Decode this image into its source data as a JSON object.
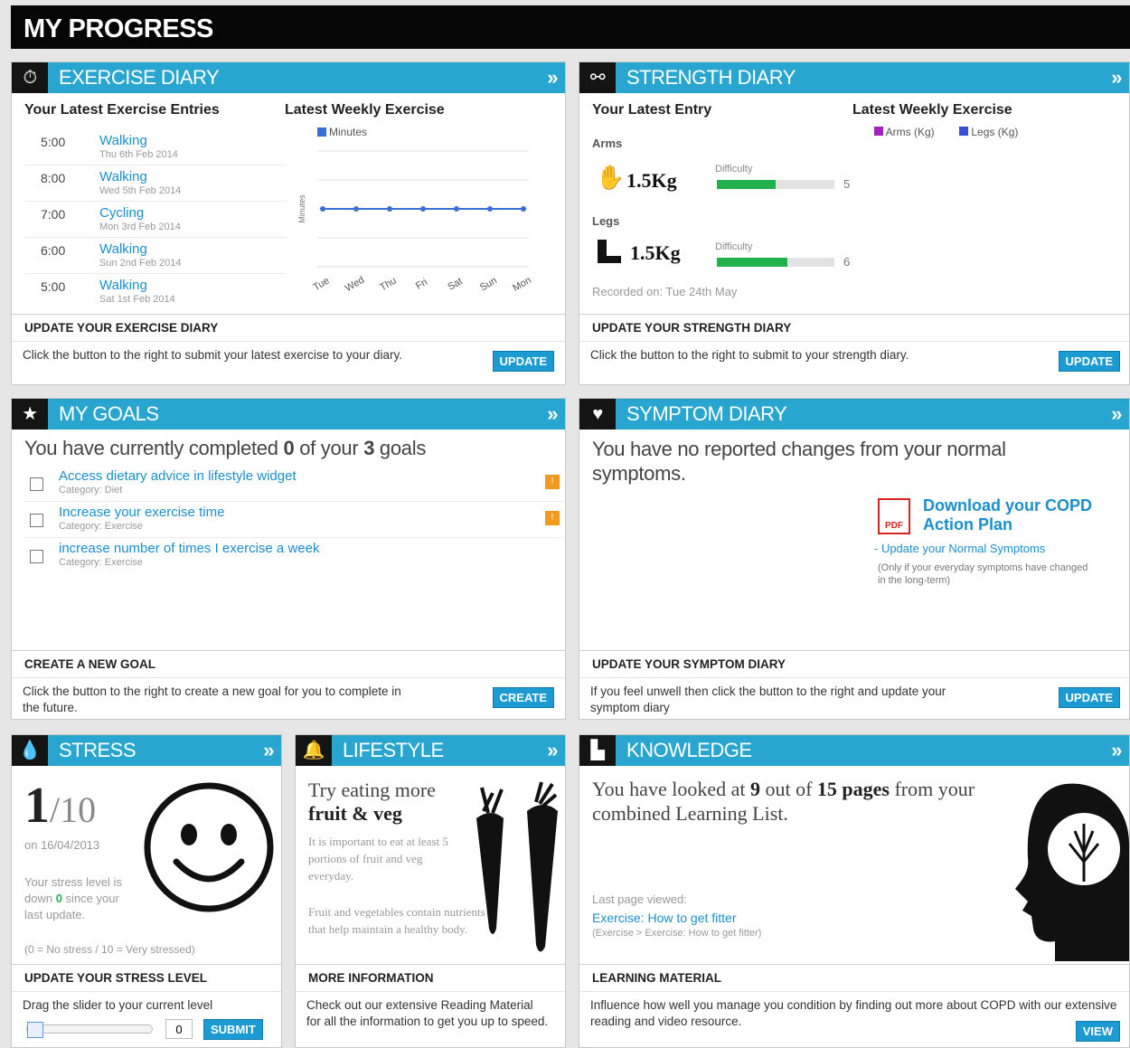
{
  "page_title": "MY PROGRESS",
  "exercise": {
    "title": "EXERCISE DIARY",
    "entries_heading": "Your Latest Exercise Entries",
    "entries": [
      {
        "time": "5:00",
        "activity": "Walking",
        "date": "Thu 6th Feb 2014"
      },
      {
        "time": "8:00",
        "activity": "Walking",
        "date": "Wed 5th Feb 2014"
      },
      {
        "time": "7:00",
        "activity": "Cycling",
        "date": "Mon 3rd Feb 2014"
      },
      {
        "time": "6:00",
        "activity": "Walking",
        "date": "Sun 2nd Feb 2014"
      },
      {
        "time": "5:00",
        "activity": "Walking",
        "date": "Sat 1st Feb 2014"
      }
    ],
    "chart_heading": "Latest Weekly Exercise",
    "footer_title": "UPDATE YOUR EXERCISE DIARY",
    "footer_text": "Click the button to the right to submit your latest exercise to your diary.",
    "button": "UPDATE"
  },
  "chart_data": {
    "type": "line",
    "categories": [
      "Tue",
      "Wed",
      "Thu",
      "Fri",
      "Sat",
      "Sun",
      "Mon"
    ],
    "series": [
      {
        "name": "Minutes",
        "values": [
          5,
          5,
          5,
          5,
          5,
          5,
          5
        ]
      }
    ],
    "ylabel": "Minutes",
    "color": "#3a6fd8"
  },
  "strength": {
    "title": "STRENGTH DIARY",
    "entry_heading": "Your Latest Entry",
    "weekly_heading": "Latest Weekly Exercise",
    "legend": [
      {
        "name": "Arms (Kg)",
        "color": "#a020c0"
      },
      {
        "name": "Legs (Kg)",
        "color": "#3a4fd8"
      }
    ],
    "arms_label": "Arms",
    "arms_value": "1.5Kg",
    "arms_difficulty": 5,
    "legs_label": "Legs",
    "legs_value": "1.5Kg",
    "legs_difficulty": 6,
    "difficulty_label": "Difficulty",
    "recorded": "Recorded on: Tue 24th May",
    "footer_title": "UPDATE YOUR STRENGTH DIARY",
    "footer_text": "Click the button to the right to submit to your strength diary.",
    "button": "UPDATE"
  },
  "goals": {
    "title": "MY GOALS",
    "summary_pre": "You have currently completed ",
    "completed": "0",
    "summary_mid": " of your ",
    "total": "3",
    "summary_post": " goals",
    "items": [
      {
        "label": "Access dietary advice in lifestyle widget",
        "category": "Category: Diet"
      },
      {
        "label": "Increase your exercise time",
        "category": "Category: Exercise"
      },
      {
        "label": "increase number of times I exercise a week",
        "category": "Category: Exercise"
      }
    ],
    "footer_title": "CREATE A NEW GOAL",
    "footer_text": "Click the button to the right to create a new goal for you to complete in the future.",
    "button": "CREATE"
  },
  "symptom": {
    "title": "SYMPTOM DIARY",
    "message": "You have no reported changes from your normal symptoms.",
    "download_link": "Download your COPD Action Plan",
    "update_link": "- Update your Normal Symptoms",
    "note": "(Only if your everyday symptoms have changed in the long-term)",
    "footer_title": "UPDATE YOUR SYMPTOM DIARY",
    "footer_text": "If you feel unwell then click the button to the right and update your symptom diary",
    "button": "UPDATE"
  },
  "stress": {
    "title": "STRESS",
    "level": "1",
    "max": "/10",
    "date": "on 16/04/2013",
    "desc_pre": "Your stress level is down ",
    "change": "0",
    "desc_post": " since your last update.",
    "scale": "(0 = No stress / 10 = Very stressed)",
    "footer_title": "UPDATE YOUR STRESS LEVEL",
    "footer_text": "Drag the slider to your current level",
    "input_value": "0",
    "slider_value": 0,
    "button": "SUBMIT"
  },
  "lifestyle": {
    "title": "LIFESTYLE",
    "headline1": "Try eating more",
    "headline2": "fruit & veg",
    "para1": "It is important to eat at least 5 portions of fruit and veg everyday.",
    "para2": "Fruit and vegetables contain nutrients that help maintain a healthy body.",
    "footer_title": "MORE INFORMATION",
    "footer_text": "Check out our extensive Reading Material for all the information to get you up to speed."
  },
  "knowledge": {
    "title": "KNOWLEDGE",
    "pre": "You have looked at ",
    "viewed": "9",
    "mid": " out of ",
    "total": "15 pages",
    "post": " from your combined Learning List.",
    "last_label": "Last page viewed:",
    "last_link": "Exercise: How to get fitter",
    "last_path": "(Exercise > Exercise: How to get fitter)",
    "footer_title": "LEARNING MATERIAL",
    "footer_text": "Influence how well you manage you condition by finding out more about COPD with our extensive reading and video resource.",
    "button": "VIEW"
  },
  "icons": {
    "exercise": "stopwatch-icon",
    "strength": "dumbbell-icon",
    "goals": "star-icon",
    "symptom": "heart-icon",
    "stress": "drop-icon",
    "lifestyle": "bell-icon",
    "knowledge": "book-icon"
  },
  "colors": {
    "header": "#29a6cf",
    "icon_bg": "#141414",
    "button": "#1c9bd3",
    "link": "#1a8fd0",
    "progress": "#22b14c",
    "flag": "#f29a1e"
  }
}
